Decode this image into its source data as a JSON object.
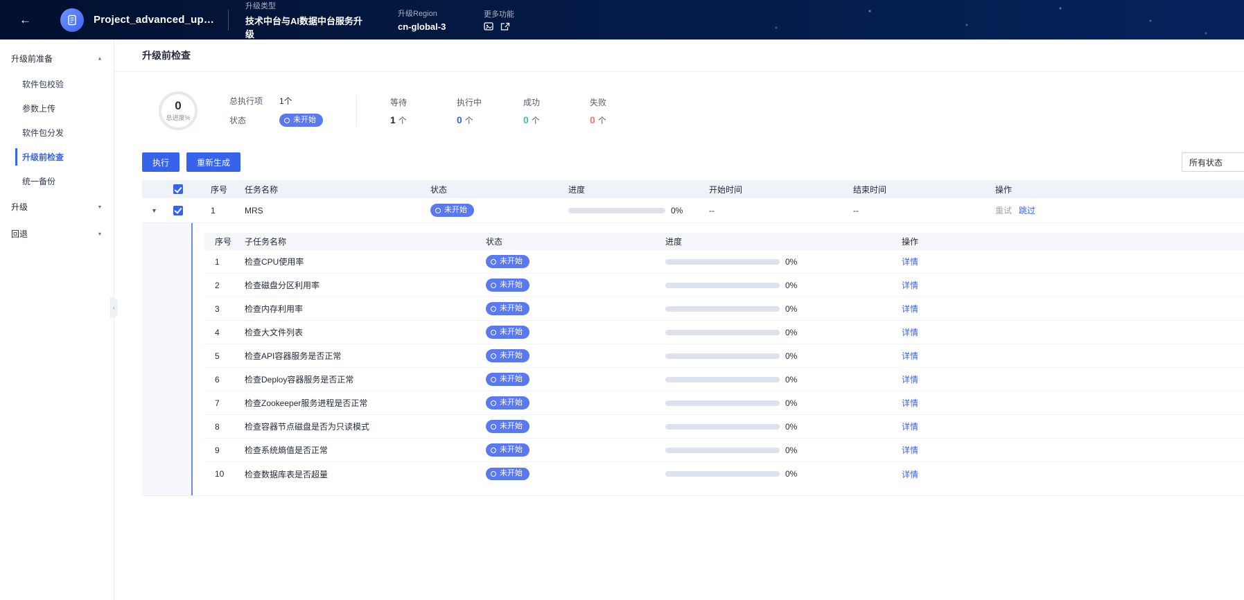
{
  "colors": {
    "accent": "#3662EC",
    "badge_blue": "#5A78F0",
    "success": "#3AC295",
    "danger": "#F66F6A",
    "header_bg": "#041A45"
  },
  "header": {
    "project_title": "Project_advanced_upg...",
    "upgrade_type": {
      "label": "升级类型",
      "value": "技术中台与AI数据中台服务升级"
    },
    "region": {
      "label": "升级Region",
      "value": "cn-global-3"
    },
    "more": {
      "label": "更多功能"
    }
  },
  "sidebar": {
    "groups": [
      {
        "label": "升级前准备",
        "expanded": true,
        "items": [
          "软件包校验",
          "参数上传",
          "软件包分发",
          "升级前检查",
          "统一备份"
        ],
        "active_item": "升级前检查"
      },
      {
        "label": "升级",
        "expanded": false,
        "items": []
      },
      {
        "label": "回退",
        "expanded": false,
        "items": []
      }
    ]
  },
  "page": {
    "title": "升级前检查"
  },
  "summary": {
    "progress_value": "0",
    "progress_label": "总进度%",
    "total_label": "总执行项",
    "total_value": "1个",
    "status_label": "状态",
    "status_value": "未开始",
    "stats": [
      {
        "label": "等待",
        "value": "1",
        "unit": "个"
      },
      {
        "label": "执行中",
        "value": "0",
        "unit": "个"
      },
      {
        "label": "成功",
        "value": "0",
        "unit": "个"
      },
      {
        "label": "失败",
        "value": "0",
        "unit": "个"
      }
    ]
  },
  "toolbar": {
    "execute_label": "执行",
    "regenerate_label": "重新生成",
    "filter_value": "所有状态"
  },
  "table": {
    "columns": [
      "序号",
      "任务名称",
      "状态",
      "进度",
      "开始时间",
      "结束时间",
      "操作"
    ],
    "rows": [
      {
        "index": "1",
        "name": "MRS",
        "status": "未开始",
        "progress": "0%",
        "start_time": "--",
        "end_time": "--",
        "action_retry": "重试",
        "action_skip": "跳过"
      }
    ]
  },
  "subtable": {
    "columns": [
      "序号",
      "子任务名称",
      "状态",
      "进度",
      "操作"
    ],
    "rows": [
      {
        "index": "1",
        "name": "检查CPU使用率",
        "status": "未开始",
        "progress": "0%",
        "action": "详情"
      },
      {
        "index": "2",
        "name": "检查磁盘分区利用率",
        "status": "未开始",
        "progress": "0%",
        "action": "详情"
      },
      {
        "index": "3",
        "name": "检查内存利用率",
        "status": "未开始",
        "progress": "0%",
        "action": "详情"
      },
      {
        "index": "4",
        "name": "检查大文件列表",
        "status": "未开始",
        "progress": "0%",
        "action": "详情"
      },
      {
        "index": "5",
        "name": "检查API容器服务是否正常",
        "status": "未开始",
        "progress": "0%",
        "action": "详情"
      },
      {
        "index": "6",
        "name": "检查Deploy容器服务是否正常",
        "status": "未开始",
        "progress": "0%",
        "action": "详情"
      },
      {
        "index": "7",
        "name": "检查Zookeeper服务进程是否正常",
        "status": "未开始",
        "progress": "0%",
        "action": "详情"
      },
      {
        "index": "8",
        "name": "检查容器节点磁盘是否为只读模式",
        "status": "未开始",
        "progress": "0%",
        "action": "详情"
      },
      {
        "index": "9",
        "name": "检查系统熵值是否正常",
        "status": "未开始",
        "progress": "0%",
        "action": "详情"
      },
      {
        "index": "10",
        "name": "检查数据库表是否超量",
        "status": "未开始",
        "progress": "0%",
        "action": "详情"
      }
    ]
  }
}
